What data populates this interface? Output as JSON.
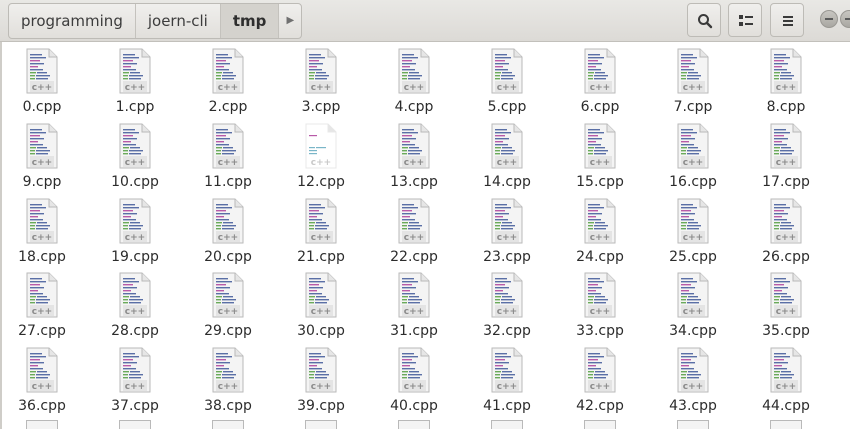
{
  "breadcrumbs": [
    {
      "label": "programming"
    },
    {
      "label": "joern-cli"
    },
    {
      "label": "tmp",
      "active": true
    }
  ],
  "toolbar": {
    "buttons": [
      "search-icon",
      "list-view-icon",
      "menu-icon"
    ]
  },
  "file_icon": {
    "type_label": "c++",
    "name": "text-x-c++src-icon"
  },
  "files": [
    {
      "name": "0.cpp"
    },
    {
      "name": "1.cpp"
    },
    {
      "name": "2.cpp"
    },
    {
      "name": "3.cpp"
    },
    {
      "name": "4.cpp"
    },
    {
      "name": "5.cpp"
    },
    {
      "name": "6.cpp"
    },
    {
      "name": "7.cpp"
    },
    {
      "name": "8.cpp"
    },
    {
      "name": "9.cpp"
    },
    {
      "name": "10.cpp"
    },
    {
      "name": "11.cpp"
    },
    {
      "name": "12.cpp",
      "selected": true
    },
    {
      "name": "13.cpp"
    },
    {
      "name": "14.cpp"
    },
    {
      "name": "15.cpp"
    },
    {
      "name": "16.cpp"
    },
    {
      "name": "17.cpp"
    },
    {
      "name": "18.cpp"
    },
    {
      "name": "19.cpp"
    },
    {
      "name": "20.cpp"
    },
    {
      "name": "21.cpp"
    },
    {
      "name": "22.cpp"
    },
    {
      "name": "23.cpp"
    },
    {
      "name": "24.cpp"
    },
    {
      "name": "25.cpp"
    },
    {
      "name": "26.cpp"
    },
    {
      "name": "27.cpp"
    },
    {
      "name": "28.cpp"
    },
    {
      "name": "29.cpp"
    },
    {
      "name": "30.cpp"
    },
    {
      "name": "31.cpp"
    },
    {
      "name": "32.cpp"
    },
    {
      "name": "33.cpp"
    },
    {
      "name": "34.cpp"
    },
    {
      "name": "35.cpp"
    },
    {
      "name": "36.cpp"
    },
    {
      "name": "37.cpp"
    },
    {
      "name": "38.cpp"
    },
    {
      "name": "39.cpp"
    },
    {
      "name": "40.cpp"
    },
    {
      "name": "41.cpp"
    },
    {
      "name": "42.cpp"
    },
    {
      "name": "43.cpp"
    },
    {
      "name": "44.cpp"
    }
  ]
}
